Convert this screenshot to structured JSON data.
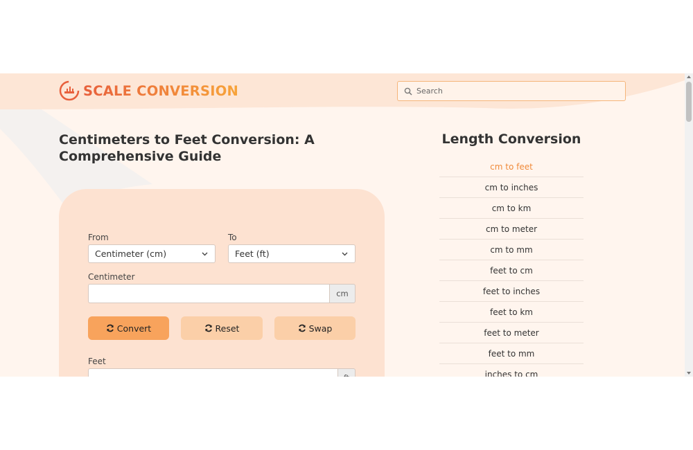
{
  "header": {
    "logo_text": "SCALE CONVERSION",
    "search_placeholder": "Search"
  },
  "page": {
    "title": "Centimeters to Feet Conversion: A Comprehensive Guide"
  },
  "converter": {
    "from_label": "From",
    "from_value": "Centimeter (cm)",
    "to_label": "To",
    "to_value": "Feet (ft)",
    "input_label": "Centimeter",
    "input_value": "",
    "input_unit": "cm",
    "convert_label": "Convert",
    "reset_label": "Reset",
    "swap_label": "Swap",
    "output_label": "Feet",
    "output_value": "",
    "output_unit": "ft"
  },
  "sidebar": {
    "title": "Length Conversion",
    "links": [
      "cm to feet",
      "cm to inches",
      "cm to km",
      "cm to meter",
      "cm to mm",
      "feet to cm",
      "feet to inches",
      "feet to km",
      "feet to meter",
      "feet to mm",
      "inches to cm"
    ],
    "active_index": 0
  },
  "colors": {
    "accent": "#f08a3a",
    "brand_start": "#e8603c",
    "brand_end": "#f7a43a",
    "card_bg": "#fde2d1",
    "page_bg": "#fff5ee"
  }
}
